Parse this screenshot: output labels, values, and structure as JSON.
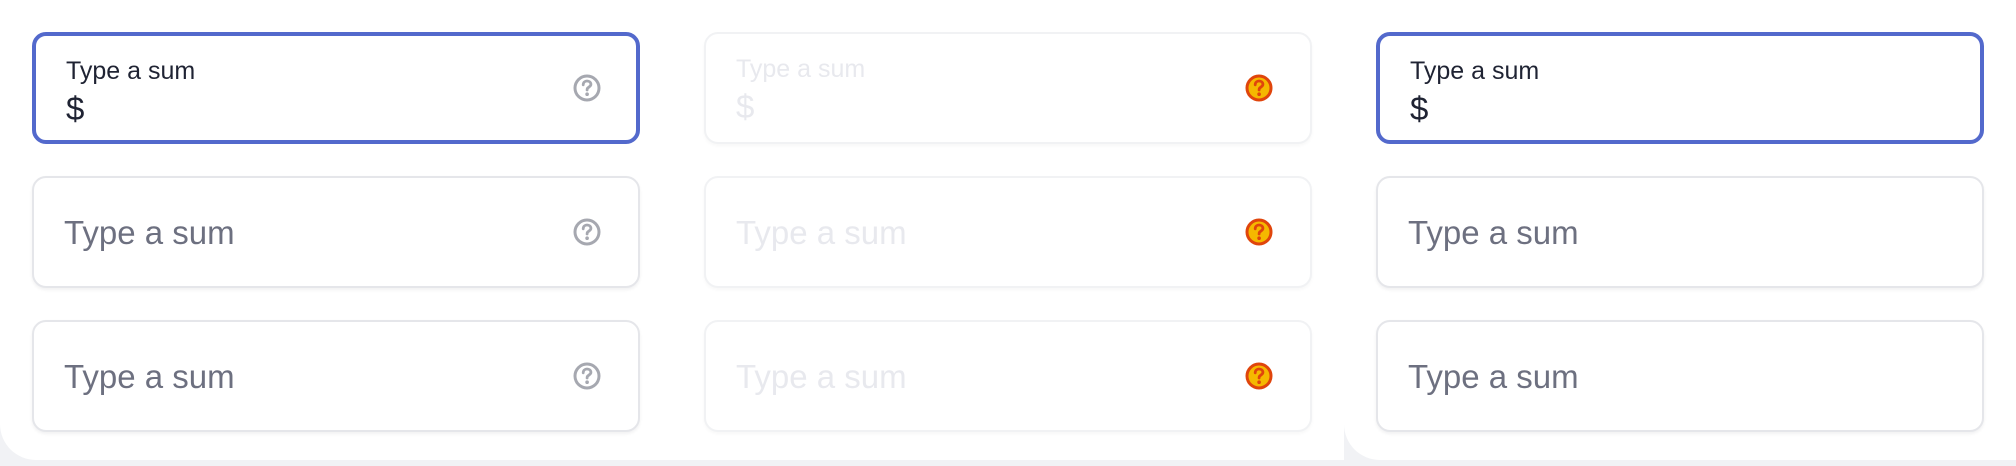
{
  "columns": [
    {
      "state": "default",
      "help_icon_color": "#a6a8b0",
      "fields": [
        {
          "type": "focused",
          "label": "Type a sum",
          "prefix": "$",
          "has_help": true
        },
        {
          "type": "empty",
          "placeholder": "Type a sum",
          "has_help": true
        },
        {
          "type": "empty",
          "placeholder": "Type a sum",
          "has_help": true
        }
      ]
    },
    {
      "state": "disabled",
      "help_icon_color": "#e0450c",
      "help_icon_fill": "#f5b800",
      "fields": [
        {
          "type": "filled",
          "label": "Type a sum",
          "prefix": "$",
          "has_help": true
        },
        {
          "type": "empty",
          "placeholder": "Type a sum",
          "has_help": true
        },
        {
          "type": "empty",
          "placeholder": "Type a sum",
          "has_help": true
        }
      ]
    },
    {
      "state": "default",
      "fields": [
        {
          "type": "focused",
          "label": "Type a sum",
          "prefix": "$",
          "has_help": false
        },
        {
          "type": "empty",
          "placeholder": "Type a sum",
          "has_help": false
        },
        {
          "type": "empty",
          "placeholder": "Type a sum",
          "has_help": false
        }
      ]
    }
  ],
  "colors": {
    "focus_border": "#5369cc",
    "border": "#e5e6ea",
    "text": "#1f2333",
    "placeholder": "#6d7080"
  },
  "icons": {
    "help": "help-circle-icon"
  }
}
